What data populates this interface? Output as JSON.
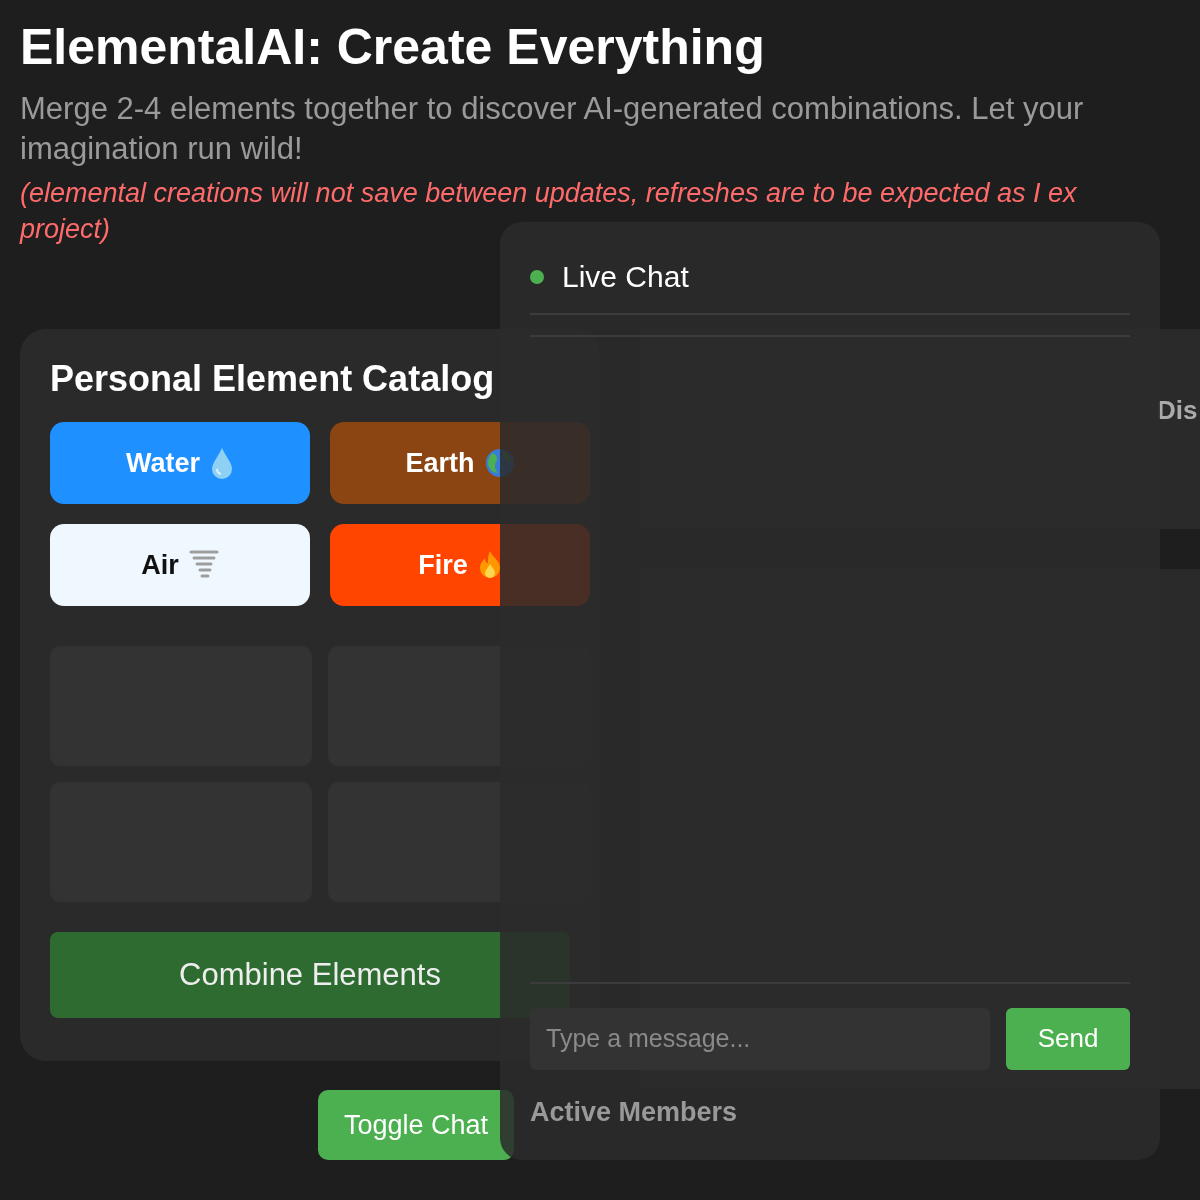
{
  "title": "ElementalAI: Create Everything",
  "intro_lines": [
    "Merge 2-4 elements together to discover AI-generated combinations. Let your",
    "imagination run wild!"
  ],
  "notice_lines": [
    "(elemental creations will not save between updates, refreshes are to be expected as I ex",
    "project)"
  ],
  "catalog": {
    "title": "Personal Element Catalog",
    "elements": [
      {
        "label": "Water",
        "kind": "water",
        "color": "#1e90ff"
      },
      {
        "label": "Earth",
        "kind": "earth",
        "color": "#8b4513"
      },
      {
        "label": "Air",
        "kind": "air",
        "color": "#f0f8ff"
      },
      {
        "label": "Fire",
        "kind": "fire",
        "color": "#ff4500"
      }
    ],
    "combine_slots": [
      {
        "empty": true
      },
      {
        "empty": true
      },
      {
        "empty": true
      },
      {
        "empty": true
      }
    ],
    "combine_button": "Combine Elements"
  },
  "stats": [
    {
      "label": "Dis"
    }
  ],
  "toggle_chat_button": "Toggle Chat",
  "chat": {
    "title": "Live Chat",
    "online": true,
    "input": {
      "placeholder": "Type a message..."
    },
    "send_button": "Send",
    "members_heading": "Active Members"
  }
}
